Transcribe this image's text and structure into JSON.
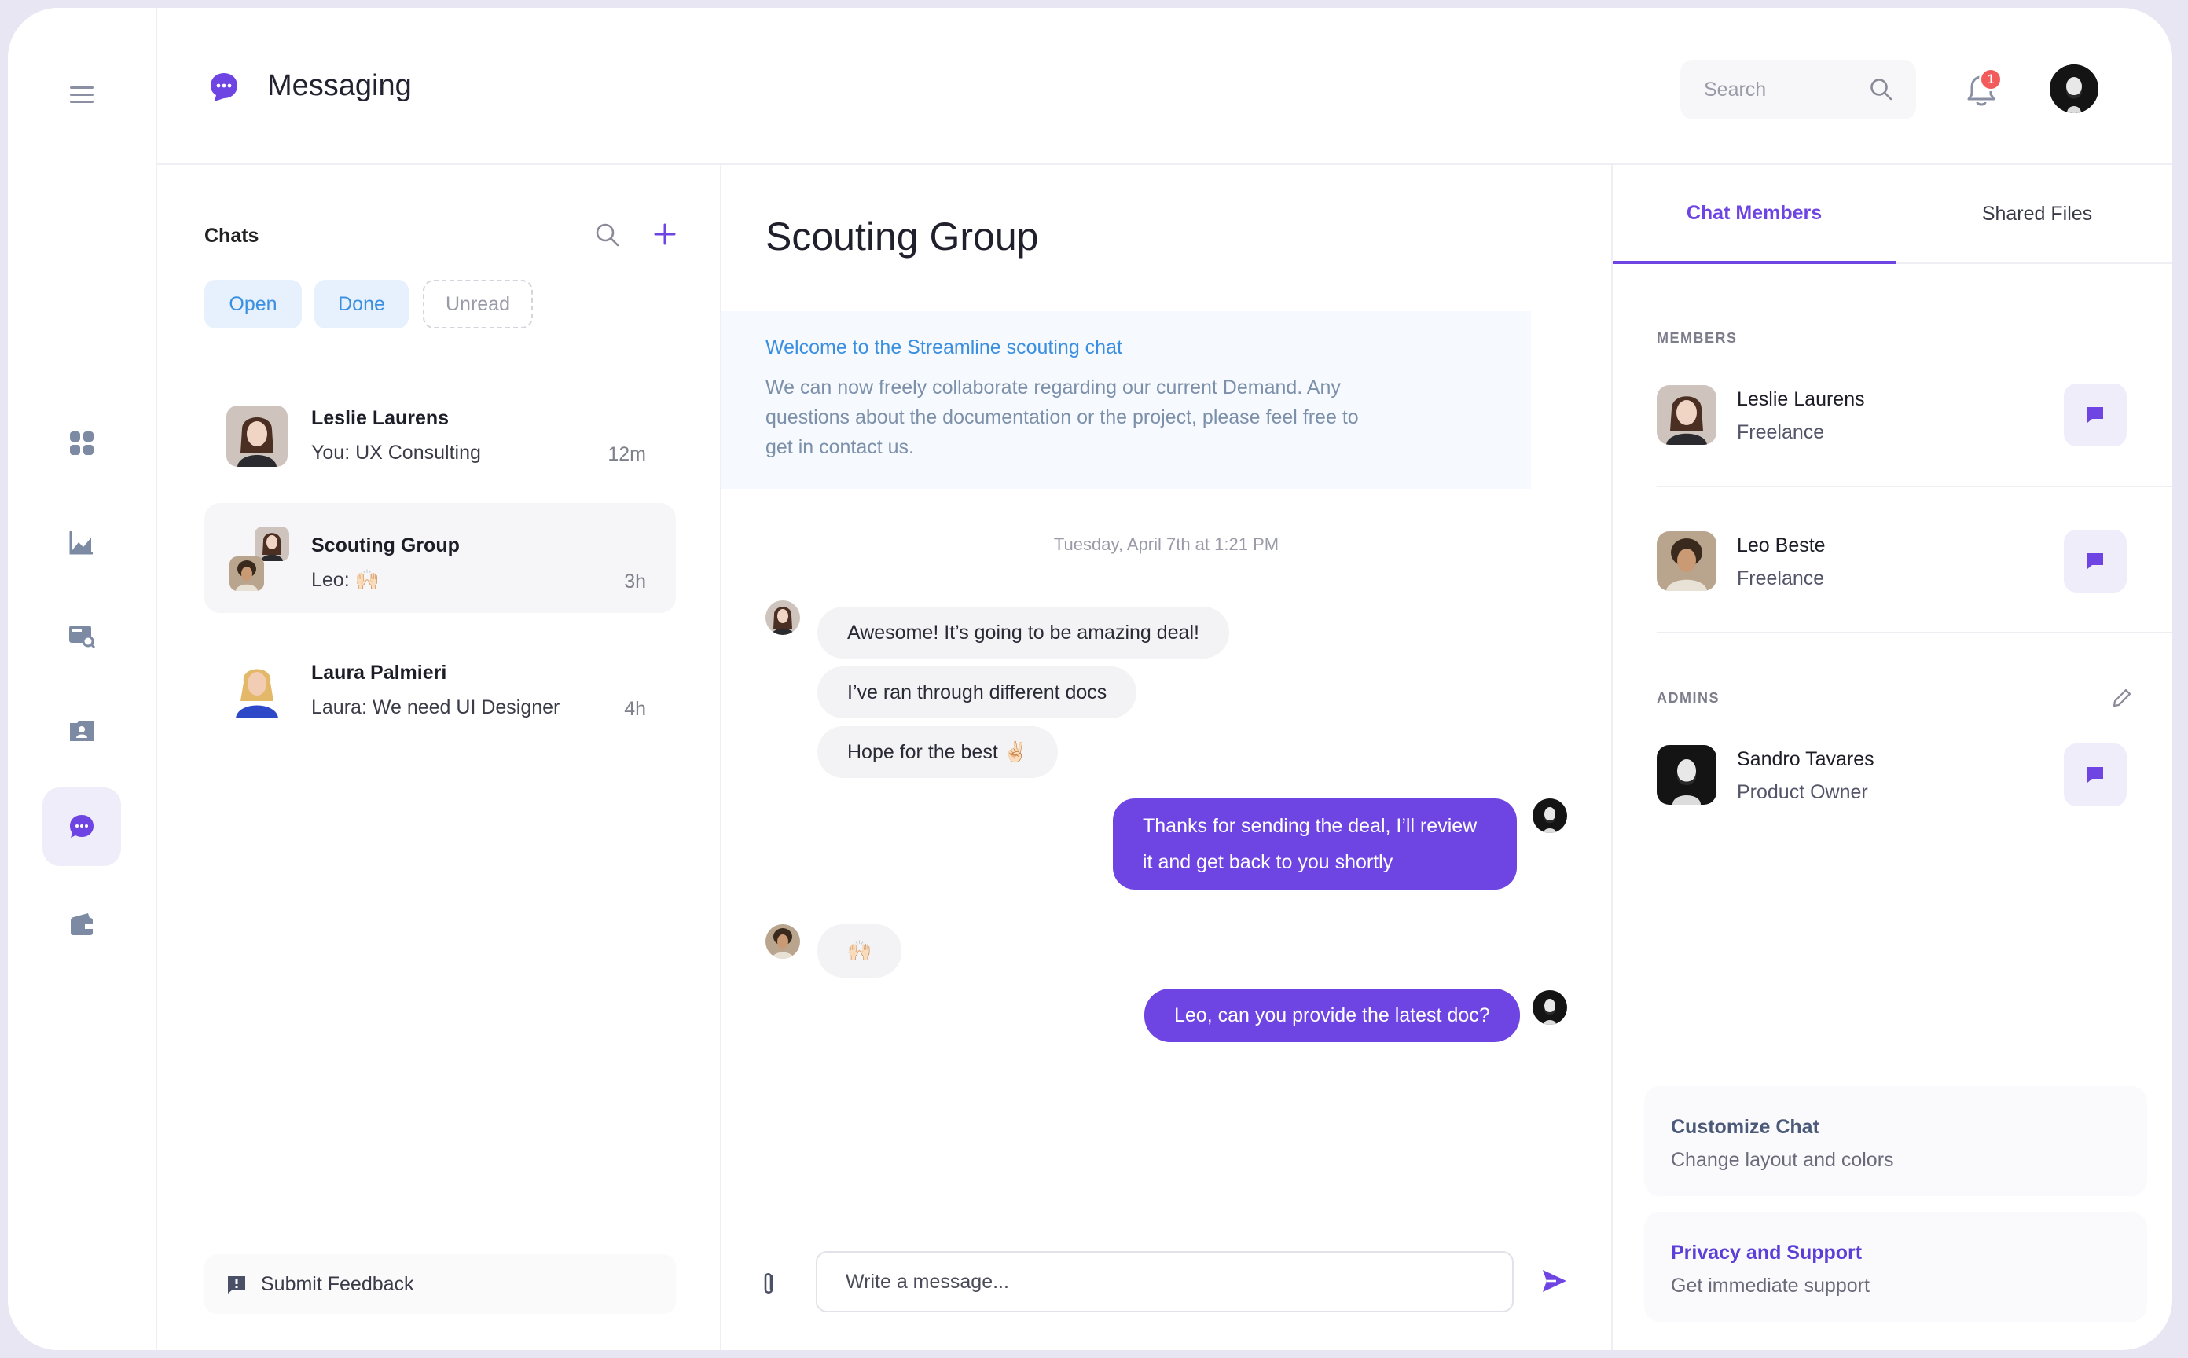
{
  "app": {
    "title": "Messaging"
  },
  "header": {
    "search_placeholder": "Search",
    "notification_count": "1"
  },
  "chatlist": {
    "title": "Chats",
    "filters": [
      "Open",
      "Done",
      "Unread"
    ],
    "items": [
      {
        "name": "Leslie Laurens",
        "preview": "You: UX Consulting",
        "time": "12m"
      },
      {
        "name": "Scouting Group",
        "preview": "Leo: 🙌🏻",
        "time": "3h"
      },
      {
        "name": "Laura Palmieri",
        "preview": "Laura: We need UI Designer",
        "time": "4h"
      }
    ],
    "feedback_label": "Submit Feedback"
  },
  "conversation": {
    "title": "Scouting Group",
    "welcome_title": "Welcome to the Streamline scouting chat",
    "welcome_body": "We can now freely collaborate regarding our current Demand. Any questions about the documentation or the project, please feel free to get in contact us.",
    "timestamp": "Tuesday, April 7th at 1:21 PM",
    "messages": [
      {
        "text": "Awesome! It’s going to be amazing deal!"
      },
      {
        "text": "I’ve ran through different docs"
      },
      {
        "text": "Hope for the best ✌🏻"
      },
      {
        "text": "Thanks for sending the deal, I’ll review it and get back to you shortly"
      },
      {
        "text": "🙌🏻"
      },
      {
        "text": "Leo, can you provide the latest doc?"
      }
    ],
    "composer_placeholder": "Write a message..."
  },
  "rightpanel": {
    "tabs": [
      "Chat Members",
      "Shared Files"
    ],
    "members_label": "MEMBERS",
    "admins_label": "ADMINS",
    "members": [
      {
        "name": "Leslie Laurens",
        "role": "Freelance"
      },
      {
        "name": "Leo Beste",
        "role": "Freelance"
      }
    ],
    "admins": [
      {
        "name": "Sandro Tavares",
        "role": "Product Owner"
      }
    ],
    "cards": [
      {
        "title": "Customize Chat",
        "subtitle": "Change layout and colors"
      },
      {
        "title": "Privacy and Support",
        "subtitle": "Get immediate support"
      }
    ]
  },
  "colors": {
    "accent": "#6e45e2",
    "link_blue": "#3a8fe0",
    "badge_red": "#f25b5b",
    "customize_title": "#4a5a78",
    "privacy_title": "#5b3fd6"
  }
}
